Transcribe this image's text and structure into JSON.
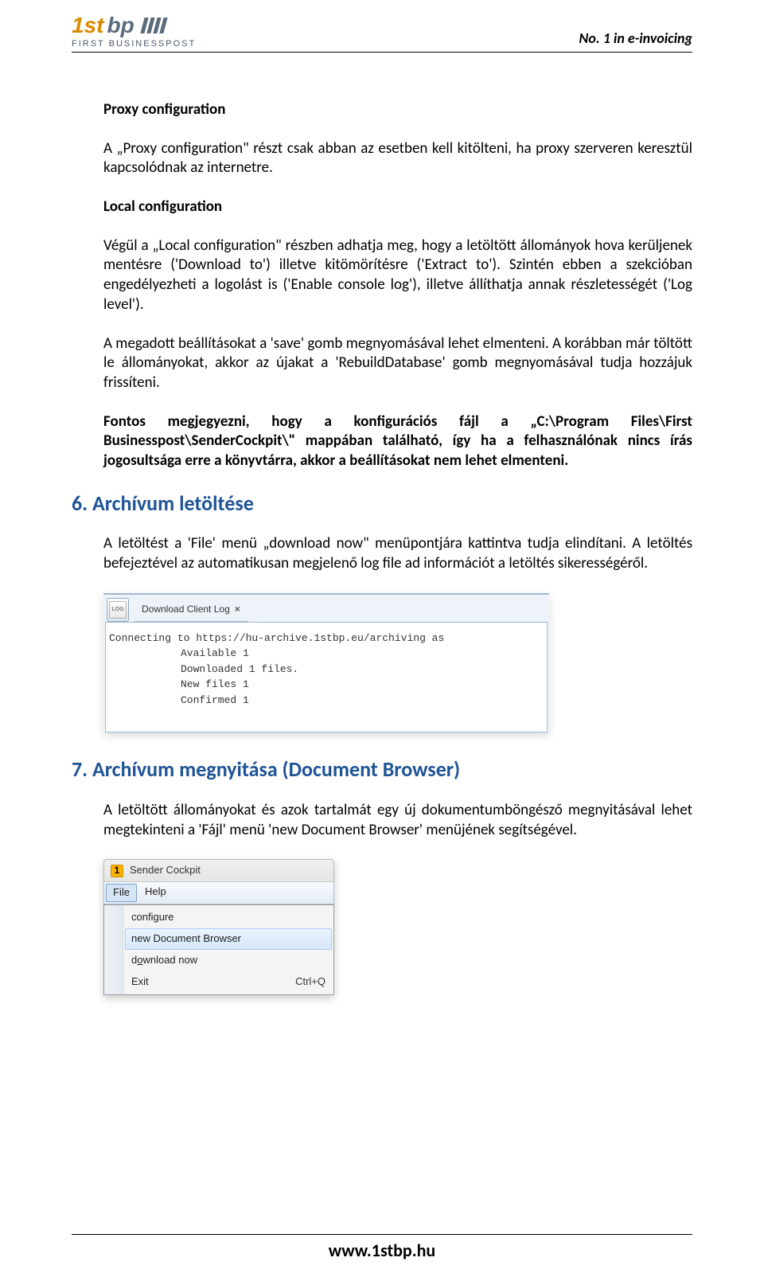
{
  "header": {
    "logo_main_a": "1st",
    "logo_main_b": "bp",
    "logo_sub": "FIRST BUSINESSPOST",
    "tagline": "No. 1 in e-invoicing"
  },
  "section_proxy": {
    "title": "Proxy configuration",
    "p1": "A „Proxy configuration\" részt csak abban az esetben kell kitölteni, ha proxy szerveren keresztül kapcsolódnak az internetre."
  },
  "section_local": {
    "title": "Local configuration",
    "p1": "Végül a „Local configuration\" részben adhatja meg, hogy a letöltött állományok hova kerüljenek mentésre ('Download to') illetve kitömörítésre ('Extract to'). Szintén ebben a szekcióban engedélyezheti a logolást is ('Enable console log'), illetve állíthatja annak részletességét ('Log level').",
    "p2": "A megadott beállításokat a 'save' gomb megnyomásával lehet elmenteni. A korábban már töltött le állományokat, akkor az újakat a 'RebuildDatabase' gomb megnyomásával tudja hozzájuk frissíteni.",
    "p3": "Fontos megjegyezni, hogy a konfigurációs fájl a „C:\\Program Files\\First Businesspost\\SenderCockpit\\\" mappában található, így ha a felhasználónak nincs írás jogosultsága erre a könyvtárra, akkor a beállításokat nem lehet elmenteni."
  },
  "section6": {
    "heading": "6. Archívum letöltése",
    "p1": "A letöltést a 'File' menü „download now\" menüpontjára kattintva tudja elindítani. A letöltés befejeztével az automatikusan megjelenő log file ad információt a letöltés sikerességéről."
  },
  "shot1": {
    "log_badge": "LOG",
    "tab_label": "Download Client Log",
    "line1": "Connecting to https://hu-archive.1stbp.eu/archiving as",
    "line2": "Available 1",
    "line3": "Downloaded 1 files.",
    "line4": "New files 1",
    "line5": "Confirmed 1"
  },
  "section7": {
    "heading": "7. Archívum megnyitása (Document Browser)",
    "p1": "A letöltött állományokat és azok tartalmát egy új dokumentumböngésző megnyitásával lehet megtekinteni a 'Fájl' menü 'new Document Browser' menüjének segítségével."
  },
  "shot2": {
    "app_icon": "1",
    "title": "Sender Cockpit",
    "menu_file": "File",
    "menu_help": "Help",
    "item1": "configure",
    "item2": "new Document Browser",
    "item3_pre": "d",
    "item3_u": "o",
    "item3_post": "wnload now",
    "item4": "Exit",
    "item4_short": "Ctrl+Q"
  },
  "footer": {
    "url": "www.1stbp.hu"
  }
}
